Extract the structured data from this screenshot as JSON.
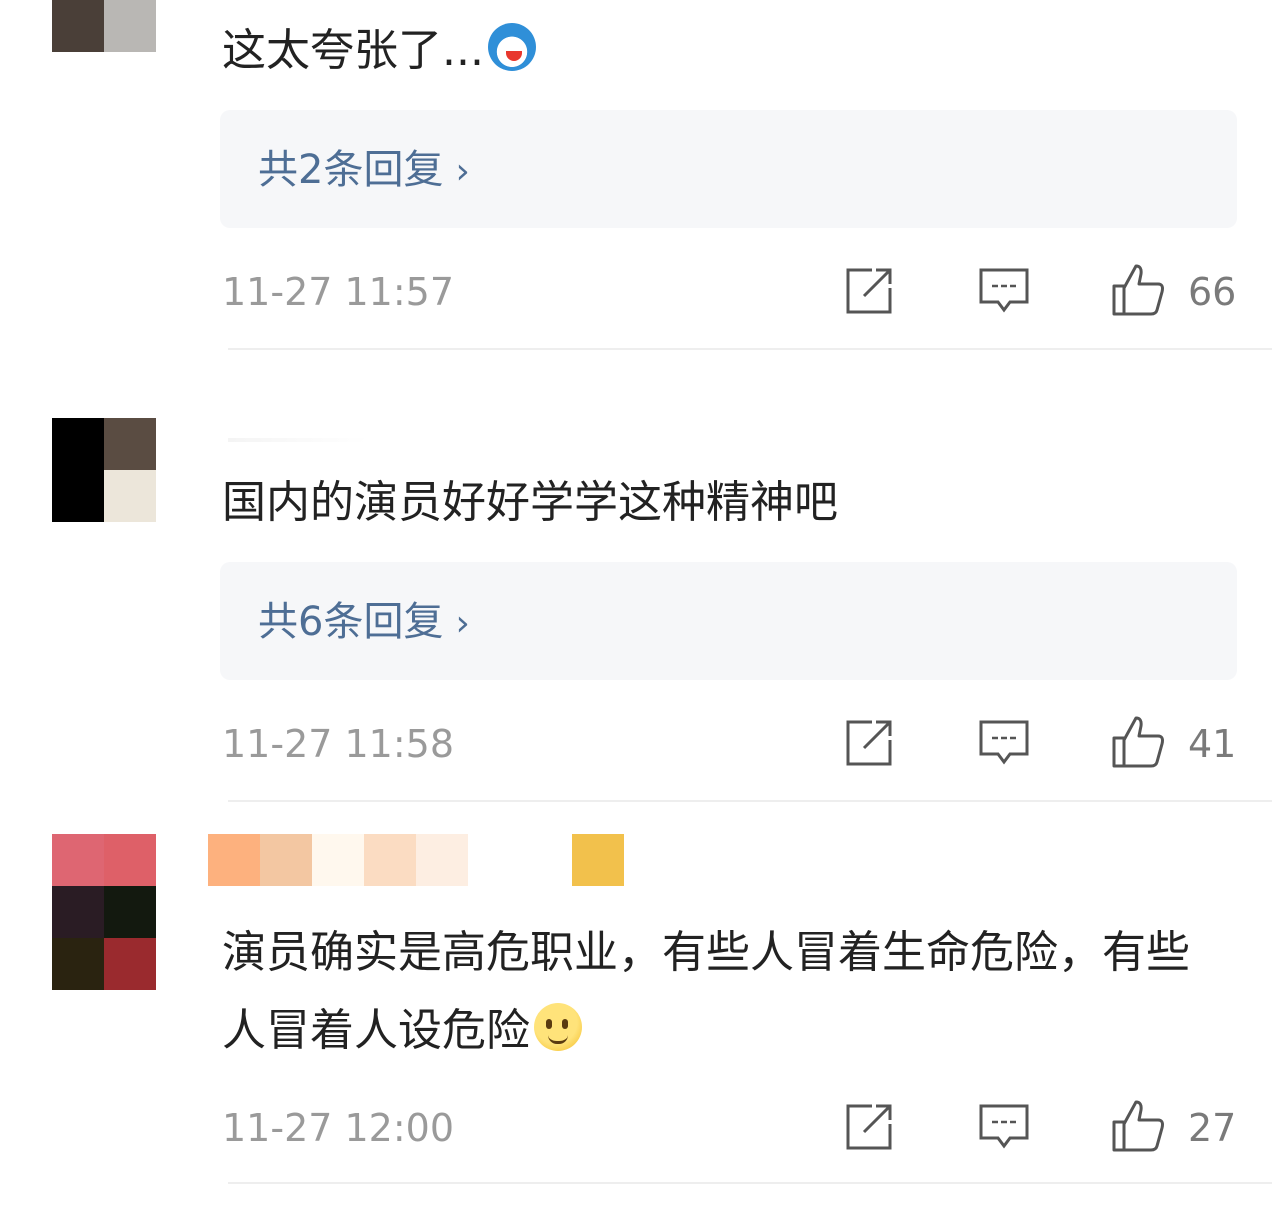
{
  "comments": [
    {
      "text": "这太夸张了...",
      "emoji": "doraemon-emoji",
      "replies_label": "共2条回复",
      "timestamp": "11-27 11:57",
      "likes": "66"
    },
    {
      "text": "国内的演员好好学学这种精神吧",
      "replies_label": "共6条回复",
      "timestamp": "11-27 11:58",
      "likes": "41"
    },
    {
      "text": "演员确实是高危职业，有些人冒着生命危险，有些人冒着人设危险",
      "emoji": "thinking-emoji",
      "timestamp": "11-27 12:00",
      "likes": "27"
    }
  ],
  "icons": {
    "share": "share-icon",
    "comment": "comment-icon",
    "like": "thumbs-up-icon",
    "chevron": "chevron-right-icon"
  },
  "colors": {
    "reply_link": "#4e6e95",
    "timestamp": "#9a9a9a",
    "reply_box_bg": "#f6f7f9"
  }
}
